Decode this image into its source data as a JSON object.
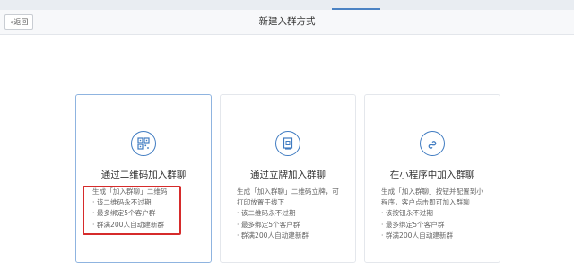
{
  "header": {
    "back_label": "返回",
    "title": "新建入群方式"
  },
  "cards": [
    {
      "title": "通过二维码加入群聊",
      "icon": "qrcode-icon",
      "lines": [
        "生成「加入群聊」二维码",
        "· 该二维码永不过期",
        "· 最多绑定5个客户群",
        "· 群满200人自动建新群"
      ],
      "selected": true
    },
    {
      "title": "通过立牌加入群聊",
      "icon": "standee-icon",
      "lines": [
        "生成「加入群聊」二维码立牌，可",
        "打印放置于线下",
        "· 该二维码永不过期",
        "· 最多绑定5个客户群",
        "· 群满200人自动建新群"
      ],
      "selected": false
    },
    {
      "title": "在小程序中加入群聊",
      "icon": "miniprogram-icon",
      "lines": [
        "生成「加入群聊」按钮并配置到小",
        "程序，客户点击即可加入群聊",
        "· 该按钮永不过期",
        "· 最多绑定5个客户群",
        "· 群满200人自动建新群"
      ],
      "selected": false
    }
  ],
  "colors": {
    "accent": "#3f7bc1",
    "annotation": "#d62b2b"
  }
}
